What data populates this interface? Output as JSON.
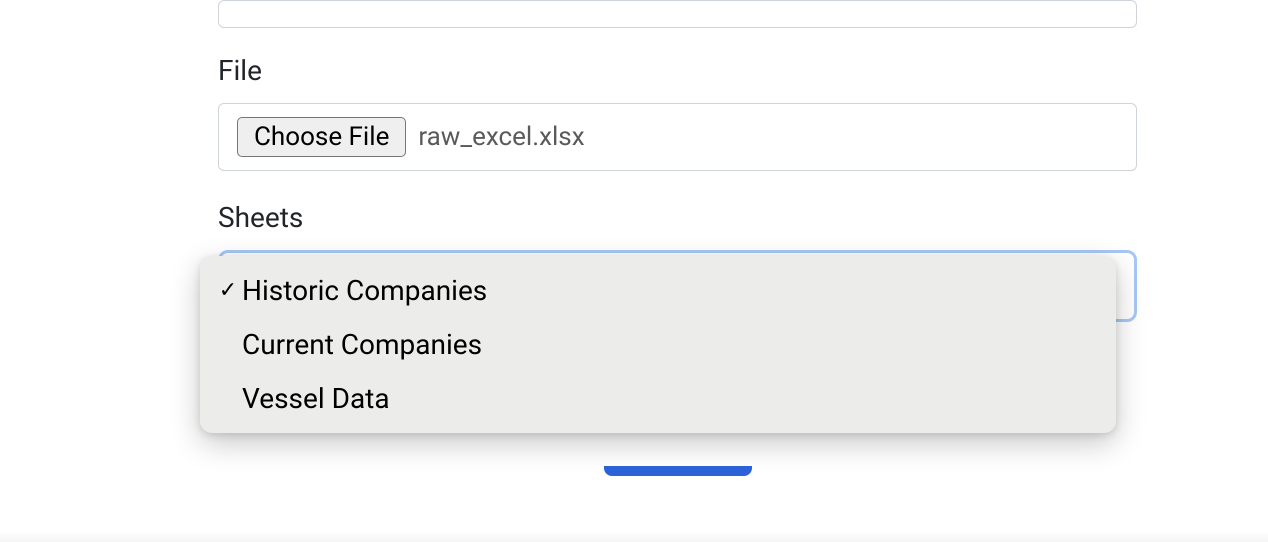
{
  "form": {
    "file": {
      "label": "File",
      "button_label": "Choose File",
      "filename": "raw_excel.xlsx"
    },
    "sheets": {
      "label": "Sheets",
      "options": [
        {
          "label": "Historic Companies",
          "selected": true
        },
        {
          "label": "Current Companies",
          "selected": false
        },
        {
          "label": "Vessel Data",
          "selected": false
        }
      ]
    }
  }
}
